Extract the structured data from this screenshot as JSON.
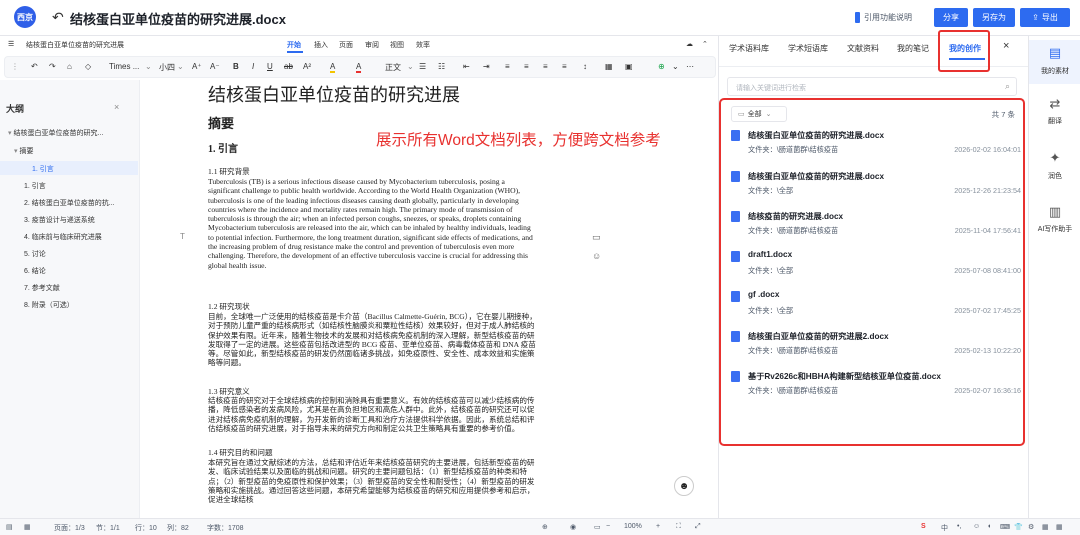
{
  "window": {
    "title": "结核蛋白亚单位疫苗的研究进展.docx",
    "logo_text": "西京",
    "cite_label": "引用功能说明",
    "share": "分享",
    "save_as": "另存为",
    "export": "导出"
  },
  "menu": {
    "doc_name": "结核蛋白亚单位疫苗的研究进展",
    "tabs": [
      "开始",
      "插入",
      "页面",
      "审阅",
      "视图",
      "效率"
    ]
  },
  "format_bar": {
    "font": "Times ...",
    "size": "小四",
    "style": "正文"
  },
  "outline": {
    "title": "大纲",
    "items": [
      "结核蛋白亚单位疫苗的研究...",
      "摘要",
      "1. 引言",
      "1. 引言",
      "2. 结核蛋白亚单位疫苗的抗...",
      "3. 疫苗设计与递送系统",
      "4. 临床前与临床研究进展",
      "5. 讨论",
      "6. 结论",
      "7. 参考文献",
      "8. 附录（可选）"
    ]
  },
  "document": {
    "title": "结核蛋白亚单位疫苗的研究进展",
    "abstract": "摘要",
    "section": "1.  引言",
    "sub1": "1.1 研究背景",
    "para_en": "Tuberculosis (TB) is a serious infectious disease caused by Mycobacterium tuberculosis, posing a significant challenge to public health worldwide. According to the World Health Organization (WHO), tuberculosis is one of the leading infectious diseases causing death globally, particularly in developing countries where the incidence and mortality rates remain high. The primary mode of transmission of tuberculosis is through the air; when an infected person coughs, sneezes, or speaks, droplets containing Mycobacterium tuberculosis are released into the air, which can be inhaled by healthy individuals, leading to potential infection. Furthermore, the long treatment duration, significant side effects of medications, and the increasing problem of drug resistance make the control and prevention of tuberculosis even more challenging. Therefore, the development of an effective tuberculosis vaccine is crucial for addressing this global health issue.",
    "sub2": "1.2 研究现状",
    "para_cn1": "目前，全球唯一广泛使用的结核疫苗是卡介苗（Bacillus Calmette-Guérin, BCG），它在婴儿期接种，对于预防儿童严重的结核病形式（如结核性脑膜炎和粟粒性结核）效果较好，但对于成人肺结核的保护效果有限。近年来，随着生物技术的发展和对结核病免疫机制的深入理解，新型结核疫苗的研发取得了一定的进展。这些疫苗包括改进型的 BCG 疫苗、亚单位疫苗、病毒载体疫苗和 DNA 疫苗等。尽管如此，新型结核疫苗的研发仍然面临诸多挑战，如免疫原性、安全性、成本效益和实施策略等问题。",
    "sub3": "1.3 研究意义",
    "para_cn2": "结核疫苗的研究对于全球结核病的控制和消除具有重要意义。有效的结核疫苗可以减少结核病的传播，降低感染者的发病风险，尤其是在高负担地区和高危人群中。此外，结核疫苗的研究还可以促进对结核病免疫机制的理解，为开发新的诊断工具和治疗方法提供科学依据。因此，系统总结和评估结核疫苗的研究进展，对于指导未来的研究方向和制定公共卫生策略具有重要的参考价值。",
    "sub4": "1.4 研究目的和问题",
    "para_cn3": "本研究旨在通过文献综述的方法，总结和评估近年来结核疫苗研究的主要进展，包括新型疫苗的研发、临床试验结果以及面临的挑战和问题。研究的主要问题包括：（1）新型结核疫苗的种类和特点；（2）新型疫苗的免疫原性和保护效果；（3）新型疫苗的安全性和耐受性；（4）新型疫苗的研发策略和实施挑战。通过回答这些问题，本研究希望能够为结核疫苗的研究和应用提供参考和启示，促进全球结核"
  },
  "annotation": "展示所有Word文档列表，方便跨文档参考",
  "panel": {
    "tabs": [
      "学术语料库",
      "学术短语库",
      "文献资料",
      "我的笔记",
      "我的创作"
    ],
    "search_placeholder": "请输入关键词进行检索",
    "filter": "全部",
    "count": "共 7 条",
    "files": [
      {
        "name": "结核蛋白亚单位疫苗的研究进展.docx",
        "loc": "文件夹：\\肠道菌群\\结核疫苗",
        "time": "2026-02-02 16:04:01"
      },
      {
        "name": "结核蛋白亚单位疫苗的研究进展.docx",
        "loc": "文件夹：\\全部",
        "time": "2025-12-26 21:23:54"
      },
      {
        "name": "结核疫苗的研究进展.docx",
        "loc": "文件夹：\\肠道菌群\\结核疫苗",
        "time": "2025-11-04 17:56:41"
      },
      {
        "name": "draft1.docx",
        "loc": "文件夹：\\全部",
        "time": "2025-07-08 08:41:00"
      },
      {
        "name": "gf .docx",
        "loc": "文件夹：\\全部",
        "time": "2025-07-02 17:45:25"
      },
      {
        "name": "结核蛋白亚单位疫苗的研究进展2.docx",
        "loc": "文件夹：\\肠道菌群\\结核疫苗",
        "time": "2025-02-13 10:22:20"
      },
      {
        "name": "基于Rv2626c和HBHA构建新型结核亚单位疫苗.docx",
        "loc": "文件夹：\\肠道菌群\\结核疫苗",
        "time": "2025-02-07 16:36:16"
      }
    ]
  },
  "sidebar": {
    "items": [
      "我的素材",
      "翻译",
      "润色",
      "AI写作助手"
    ]
  },
  "status": {
    "pages": "页面：1/3",
    "section": "节：1/1",
    "row": "行：10",
    "col": "列：82",
    "words": "字数：1708",
    "zoom": "100%",
    "ime": "中"
  }
}
